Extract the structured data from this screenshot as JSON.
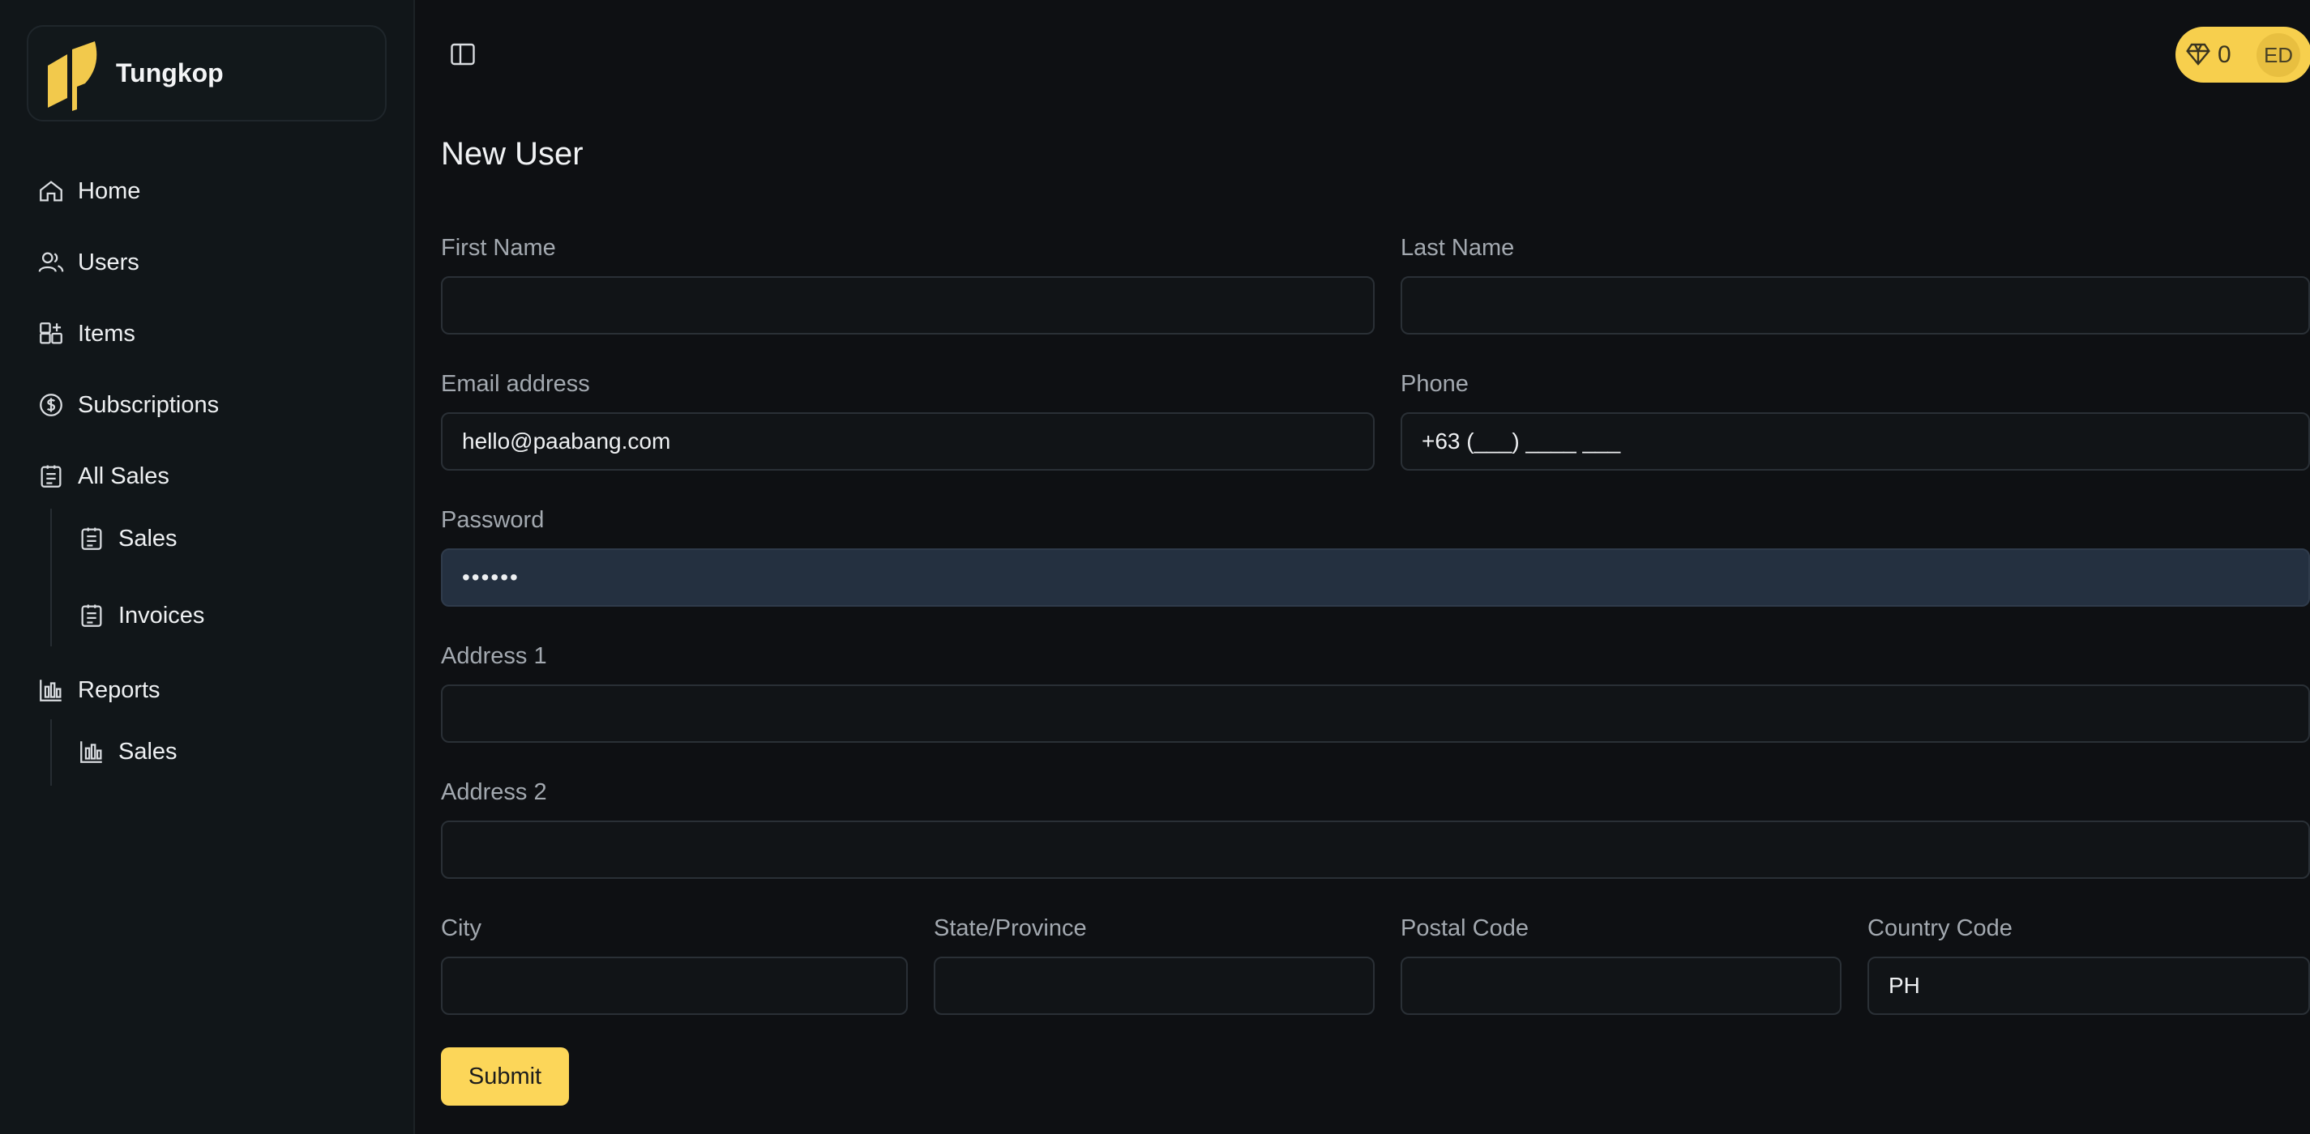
{
  "brand": {
    "name": "Tungkop"
  },
  "sidebar": {
    "items": [
      {
        "label": "Home",
        "icon": "home-icon"
      },
      {
        "label": "Users",
        "icon": "users-icon"
      },
      {
        "label": "Items",
        "icon": "grid-plus-icon"
      },
      {
        "label": "Subscriptions",
        "icon": "dollar-coin-icon"
      },
      {
        "label": "All Sales",
        "icon": "clipboard-list-icon",
        "children": [
          {
            "label": "Sales",
            "icon": "clipboard-list-icon"
          },
          {
            "label": "Invoices",
            "icon": "clipboard-list-icon"
          }
        ]
      },
      {
        "label": "Reports",
        "icon": "bar-chart-icon",
        "children": [
          {
            "label": "Sales",
            "icon": "bar-chart-icon"
          }
        ]
      }
    ]
  },
  "header": {
    "gem_count": "0",
    "avatar_initials": "ED"
  },
  "form": {
    "title": "New User",
    "first_name": {
      "label": "First Name",
      "value": ""
    },
    "last_name": {
      "label": "Last Name",
      "value": ""
    },
    "email": {
      "label": "Email address",
      "value": "hello@paabang.com"
    },
    "phone": {
      "label": "Phone",
      "value": "+63 (___) ____ ___"
    },
    "password": {
      "label": "Password",
      "value": "••••••"
    },
    "address1": {
      "label": "Address 1",
      "value": ""
    },
    "address2": {
      "label": "Address 2",
      "value": ""
    },
    "city": {
      "label": "City",
      "value": ""
    },
    "state": {
      "label": "State/Province",
      "value": ""
    },
    "postal": {
      "label": "Postal Code",
      "value": ""
    },
    "country": {
      "label": "Country Code",
      "value": "PH"
    },
    "submit_label": "Submit"
  },
  "colors": {
    "accent": "#fcd659",
    "background": "#0e1013",
    "sidebar": "#111619"
  }
}
